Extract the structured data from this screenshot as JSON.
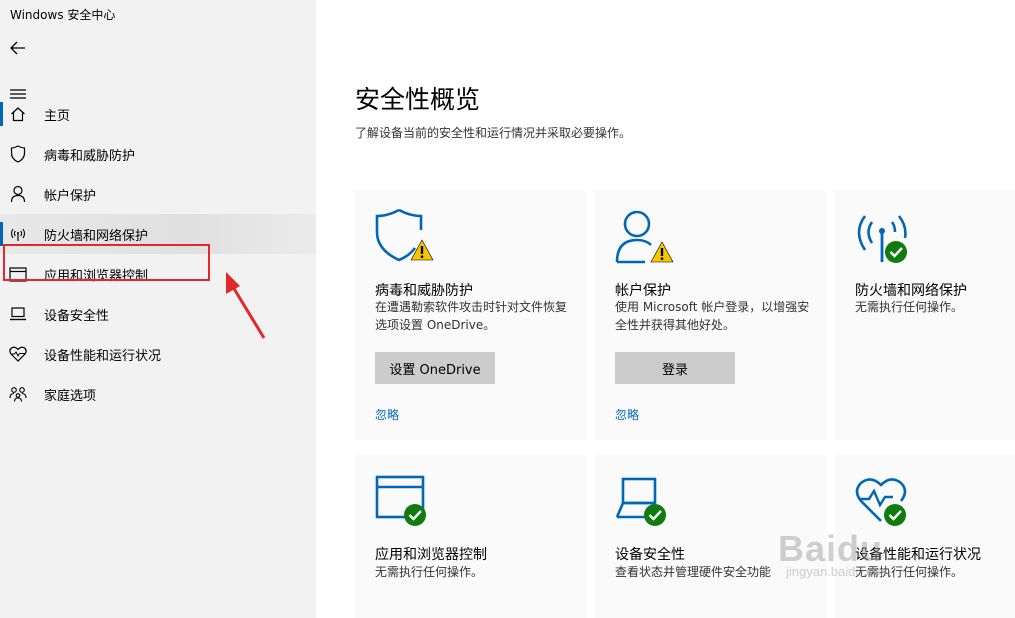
{
  "window": {
    "title": "Windows 安全中心"
  },
  "sidebar": {
    "items": [
      {
        "label": "主页",
        "icon": "home-icon"
      },
      {
        "label": "病毒和威胁防护",
        "icon": "shield-icon"
      },
      {
        "label": "帐户保护",
        "icon": "person-icon"
      },
      {
        "label": "防火墙和网络保护",
        "icon": "antenna-icon"
      },
      {
        "label": "应用和浏览器控制",
        "icon": "browser-window-icon"
      },
      {
        "label": "设备安全性",
        "icon": "laptop-icon"
      },
      {
        "label": "设备性能和运行状况",
        "icon": "heart-icon"
      },
      {
        "label": "家庭选项",
        "icon": "family-icon"
      }
    ]
  },
  "main": {
    "title": "安全性概览",
    "subtitle": "了解设备当前的安全性和运行情况并采取必要操作。",
    "cards": [
      {
        "title": "病毒和威胁防护",
        "desc": "在遭遇勒索软件攻击时针对文件恢复选项设置 OneDrive。",
        "button": "设置 OneDrive",
        "link": "忽略",
        "status": "warning"
      },
      {
        "title": "帐户保护",
        "desc": "使用 Microsoft 帐户登录，以增强安全性并获得其他好处。",
        "button": "登录",
        "link": "忽略",
        "status": "warning"
      },
      {
        "title": "防火墙和网络保护",
        "desc": "无需执行任何操作。",
        "status": "ok"
      },
      {
        "title": "应用和浏览器控制",
        "desc": "无需执行任何操作。",
        "status": "ok"
      },
      {
        "title": "设备安全性",
        "desc": "查看状态并管理硬件安全功能",
        "status": "ok"
      },
      {
        "title": "设备性能和运行状况",
        "desc": "无需执行任何操作。",
        "status": "ok"
      }
    ]
  },
  "watermark": {
    "main": "Baidu",
    "sub": "jingyan.baidu.com"
  },
  "colors": {
    "accent": "#0067b8",
    "warning": "#f7c600",
    "ok": "#107c10",
    "highlight": "#e02a2a"
  }
}
